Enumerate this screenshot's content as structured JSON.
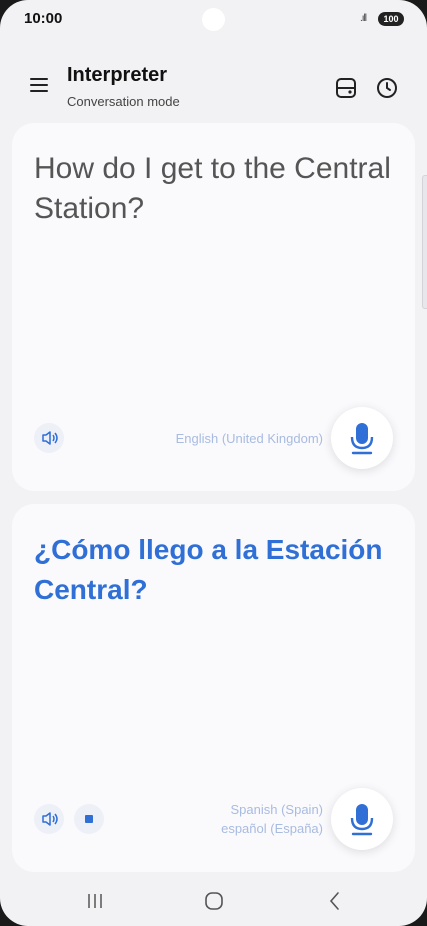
{
  "status_bar": {
    "time": "10:00",
    "signal": ".ıll",
    "battery": "100"
  },
  "header": {
    "title": "Interpreter",
    "subtitle": "Conversation mode"
  },
  "source": {
    "text": "How do I get to the Central Station?",
    "language": "English (United Kingdom)"
  },
  "target": {
    "text": "¿Cómo llego a la Estación Central?",
    "language_line1": "Spanish (Spain)",
    "language_line2": "español (España)"
  },
  "colors": {
    "accent": "#2f6fd6",
    "language_text": "#a8bbe0",
    "background": "#f2f2f5"
  },
  "icons": [
    "menu-icon",
    "layout-icon",
    "history-icon",
    "speaker-icon",
    "stop-icon",
    "chevron-down-icon",
    "microphone-icon",
    "recent-apps-icon",
    "home-icon",
    "back-icon"
  ]
}
